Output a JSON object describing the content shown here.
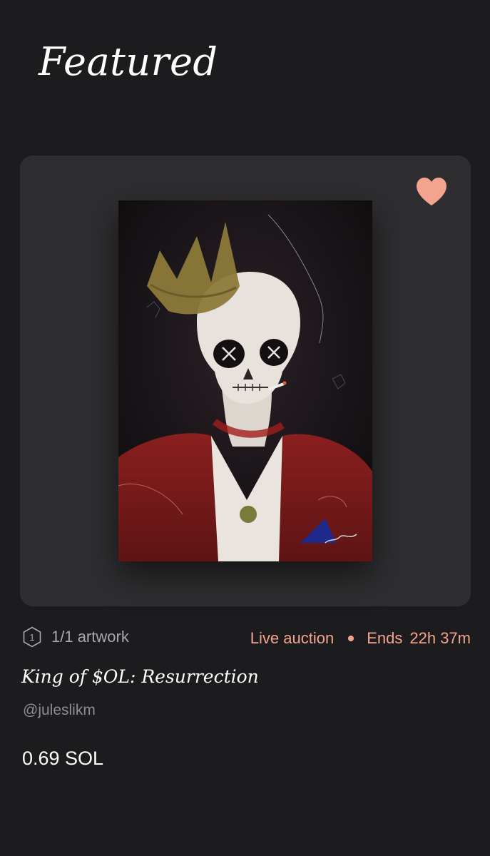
{
  "section": {
    "title": "Featured"
  },
  "artwork": {
    "image_icon": "skull-king-painting",
    "liked": true,
    "heart_icon": "heart-icon",
    "heart_color": "#f4a48e"
  },
  "meta": {
    "edition_count": "1",
    "edition_label": "1/1 artwork",
    "status": "Live auction",
    "ends_label": "Ends",
    "ends_time": "22h 37m",
    "accent_color": "#f4a48e"
  },
  "title": "King of $OL: Resurrection",
  "artist": "@juleslikm",
  "price": "0.69 SOL"
}
